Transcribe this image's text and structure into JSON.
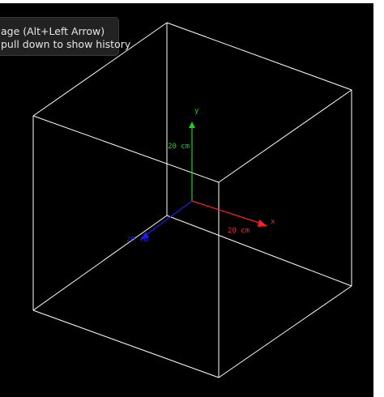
{
  "tooltip": {
    "line1": "age (Alt+Left Arrow)",
    "line2": "pull down to show history"
  },
  "scene": {
    "colors": {
      "background": "#000000",
      "box_edge": "#ffffff",
      "x_axis": "#ff2020",
      "y_axis": "#19d219",
      "z_axis": "#1e1ee6"
    },
    "axes": {
      "x": {
        "label": "x",
        "scale_label": "20 cm"
      },
      "y": {
        "label": "y",
        "scale_label": "20 cm"
      },
      "z": {
        "label": "",
        "scale_label": "20 cm"
      }
    }
  }
}
